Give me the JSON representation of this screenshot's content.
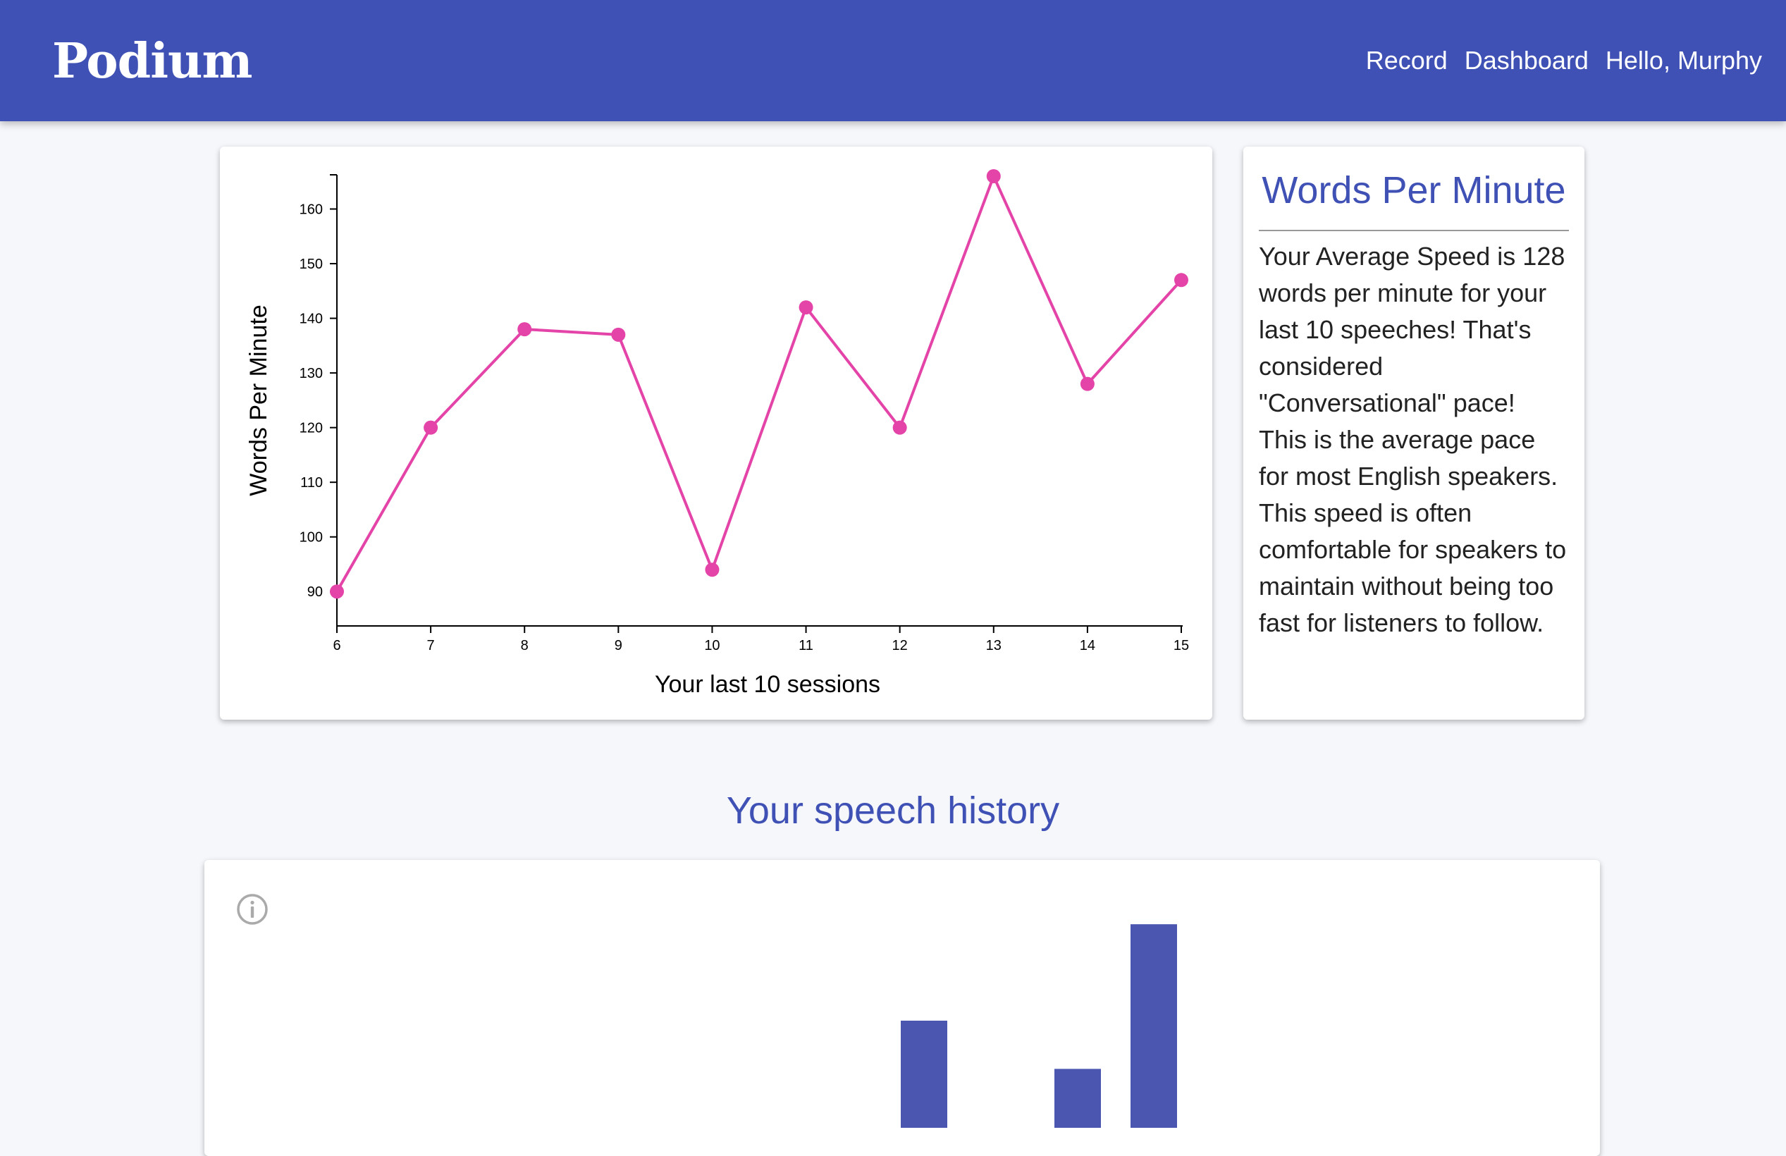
{
  "nav": {
    "brand": "Podium",
    "links": [
      "Record",
      "Dashboard",
      "Hello, Murphy"
    ]
  },
  "wpm_panel": {
    "title": "Words Per Minute",
    "text": "Your Average Speed is 128 words per minute for your last 10 speeches! That's considered \"Conversational\" pace! This is the average pace for most English speakers. This speed is often comfortable for speakers to maintain without being too fast for listeners to follow."
  },
  "history": {
    "title": "Your speech history",
    "info_icon": "info-icon"
  },
  "colors": {
    "primary": "#3f51b5",
    "line": "#e443a8",
    "bar": "#4a56b0",
    "background": "#f5f7fb"
  },
  "chart_data": [
    {
      "type": "line",
      "title": "",
      "xlabel": "Your last 10 sessions",
      "ylabel": "Words Per Minute",
      "x": [
        6,
        7,
        8,
        9,
        10,
        11,
        12,
        13,
        14,
        15
      ],
      "series": [
        {
          "values": [
            90,
            120,
            138,
            137,
            94,
            142,
            120,
            166,
            128,
            147
          ]
        }
      ],
      "xlim": [
        6,
        15
      ],
      "ylim": [
        85,
        166
      ],
      "yticks": [
        90,
        100,
        110,
        120,
        130,
        140,
        150,
        160
      ],
      "grid": false
    },
    {
      "type": "bar",
      "title": "",
      "partially_visible": true,
      "bars": [
        {
          "category_index": 0,
          "value": 0.4
        },
        {
          "category_index": 1,
          "value": 0.22
        },
        {
          "category_index": 2,
          "value": 0.76
        }
      ]
    }
  ]
}
